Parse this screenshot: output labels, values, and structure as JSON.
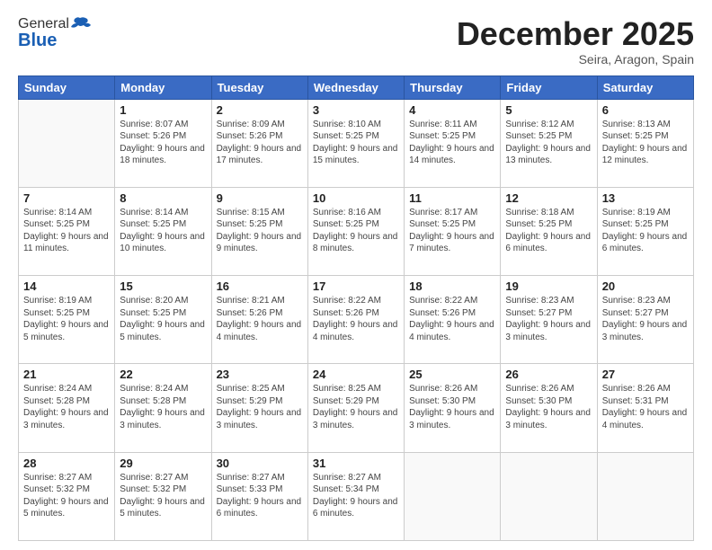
{
  "logo": {
    "general": "General",
    "blue": "Blue"
  },
  "header": {
    "month": "December 2025",
    "location": "Seira, Aragon, Spain"
  },
  "weekdays": [
    "Sunday",
    "Monday",
    "Tuesday",
    "Wednesday",
    "Thursday",
    "Friday",
    "Saturday"
  ],
  "weeks": [
    [
      {
        "day": "",
        "sunrise": "",
        "sunset": "",
        "daylight": ""
      },
      {
        "day": "1",
        "sunrise": "Sunrise: 8:07 AM",
        "sunset": "Sunset: 5:26 PM",
        "daylight": "Daylight: 9 hours and 18 minutes."
      },
      {
        "day": "2",
        "sunrise": "Sunrise: 8:09 AM",
        "sunset": "Sunset: 5:26 PM",
        "daylight": "Daylight: 9 hours and 17 minutes."
      },
      {
        "day": "3",
        "sunrise": "Sunrise: 8:10 AM",
        "sunset": "Sunset: 5:25 PM",
        "daylight": "Daylight: 9 hours and 15 minutes."
      },
      {
        "day": "4",
        "sunrise": "Sunrise: 8:11 AM",
        "sunset": "Sunset: 5:25 PM",
        "daylight": "Daylight: 9 hours and 14 minutes."
      },
      {
        "day": "5",
        "sunrise": "Sunrise: 8:12 AM",
        "sunset": "Sunset: 5:25 PM",
        "daylight": "Daylight: 9 hours and 13 minutes."
      },
      {
        "day": "6",
        "sunrise": "Sunrise: 8:13 AM",
        "sunset": "Sunset: 5:25 PM",
        "daylight": "Daylight: 9 hours and 12 minutes."
      }
    ],
    [
      {
        "day": "7",
        "sunrise": "Sunrise: 8:14 AM",
        "sunset": "Sunset: 5:25 PM",
        "daylight": "Daylight: 9 hours and 11 minutes."
      },
      {
        "day": "8",
        "sunrise": "Sunrise: 8:14 AM",
        "sunset": "Sunset: 5:25 PM",
        "daylight": "Daylight: 9 hours and 10 minutes."
      },
      {
        "day": "9",
        "sunrise": "Sunrise: 8:15 AM",
        "sunset": "Sunset: 5:25 PM",
        "daylight": "Daylight: 9 hours and 9 minutes."
      },
      {
        "day": "10",
        "sunrise": "Sunrise: 8:16 AM",
        "sunset": "Sunset: 5:25 PM",
        "daylight": "Daylight: 9 hours and 8 minutes."
      },
      {
        "day": "11",
        "sunrise": "Sunrise: 8:17 AM",
        "sunset": "Sunset: 5:25 PM",
        "daylight": "Daylight: 9 hours and 7 minutes."
      },
      {
        "day": "12",
        "sunrise": "Sunrise: 8:18 AM",
        "sunset": "Sunset: 5:25 PM",
        "daylight": "Daylight: 9 hours and 6 minutes."
      },
      {
        "day": "13",
        "sunrise": "Sunrise: 8:19 AM",
        "sunset": "Sunset: 5:25 PM",
        "daylight": "Daylight: 9 hours and 6 minutes."
      }
    ],
    [
      {
        "day": "14",
        "sunrise": "Sunrise: 8:19 AM",
        "sunset": "Sunset: 5:25 PM",
        "daylight": "Daylight: 9 hours and 5 minutes."
      },
      {
        "day": "15",
        "sunrise": "Sunrise: 8:20 AM",
        "sunset": "Sunset: 5:25 PM",
        "daylight": "Daylight: 9 hours and 5 minutes."
      },
      {
        "day": "16",
        "sunrise": "Sunrise: 8:21 AM",
        "sunset": "Sunset: 5:26 PM",
        "daylight": "Daylight: 9 hours and 4 minutes."
      },
      {
        "day": "17",
        "sunrise": "Sunrise: 8:22 AM",
        "sunset": "Sunset: 5:26 PM",
        "daylight": "Daylight: 9 hours and 4 minutes."
      },
      {
        "day": "18",
        "sunrise": "Sunrise: 8:22 AM",
        "sunset": "Sunset: 5:26 PM",
        "daylight": "Daylight: 9 hours and 4 minutes."
      },
      {
        "day": "19",
        "sunrise": "Sunrise: 8:23 AM",
        "sunset": "Sunset: 5:27 PM",
        "daylight": "Daylight: 9 hours and 3 minutes."
      },
      {
        "day": "20",
        "sunrise": "Sunrise: 8:23 AM",
        "sunset": "Sunset: 5:27 PM",
        "daylight": "Daylight: 9 hours and 3 minutes."
      }
    ],
    [
      {
        "day": "21",
        "sunrise": "Sunrise: 8:24 AM",
        "sunset": "Sunset: 5:28 PM",
        "daylight": "Daylight: 9 hours and 3 minutes."
      },
      {
        "day": "22",
        "sunrise": "Sunrise: 8:24 AM",
        "sunset": "Sunset: 5:28 PM",
        "daylight": "Daylight: 9 hours and 3 minutes."
      },
      {
        "day": "23",
        "sunrise": "Sunrise: 8:25 AM",
        "sunset": "Sunset: 5:29 PM",
        "daylight": "Daylight: 9 hours and 3 minutes."
      },
      {
        "day": "24",
        "sunrise": "Sunrise: 8:25 AM",
        "sunset": "Sunset: 5:29 PM",
        "daylight": "Daylight: 9 hours and 3 minutes."
      },
      {
        "day": "25",
        "sunrise": "Sunrise: 8:26 AM",
        "sunset": "Sunset: 5:30 PM",
        "daylight": "Daylight: 9 hours and 3 minutes."
      },
      {
        "day": "26",
        "sunrise": "Sunrise: 8:26 AM",
        "sunset": "Sunset: 5:30 PM",
        "daylight": "Daylight: 9 hours and 3 minutes."
      },
      {
        "day": "27",
        "sunrise": "Sunrise: 8:26 AM",
        "sunset": "Sunset: 5:31 PM",
        "daylight": "Daylight: 9 hours and 4 minutes."
      }
    ],
    [
      {
        "day": "28",
        "sunrise": "Sunrise: 8:27 AM",
        "sunset": "Sunset: 5:32 PM",
        "daylight": "Daylight: 9 hours and 5 minutes."
      },
      {
        "day": "29",
        "sunrise": "Sunrise: 8:27 AM",
        "sunset": "Sunset: 5:32 PM",
        "daylight": "Daylight: 9 hours and 5 minutes."
      },
      {
        "day": "30",
        "sunrise": "Sunrise: 8:27 AM",
        "sunset": "Sunset: 5:33 PM",
        "daylight": "Daylight: 9 hours and 6 minutes."
      },
      {
        "day": "31",
        "sunrise": "Sunrise: 8:27 AM",
        "sunset": "Sunset: 5:34 PM",
        "daylight": "Daylight: 9 hours and 6 minutes."
      },
      {
        "day": "",
        "sunrise": "",
        "sunset": "",
        "daylight": ""
      },
      {
        "day": "",
        "sunrise": "",
        "sunset": "",
        "daylight": ""
      },
      {
        "day": "",
        "sunrise": "",
        "sunset": "",
        "daylight": ""
      }
    ]
  ]
}
